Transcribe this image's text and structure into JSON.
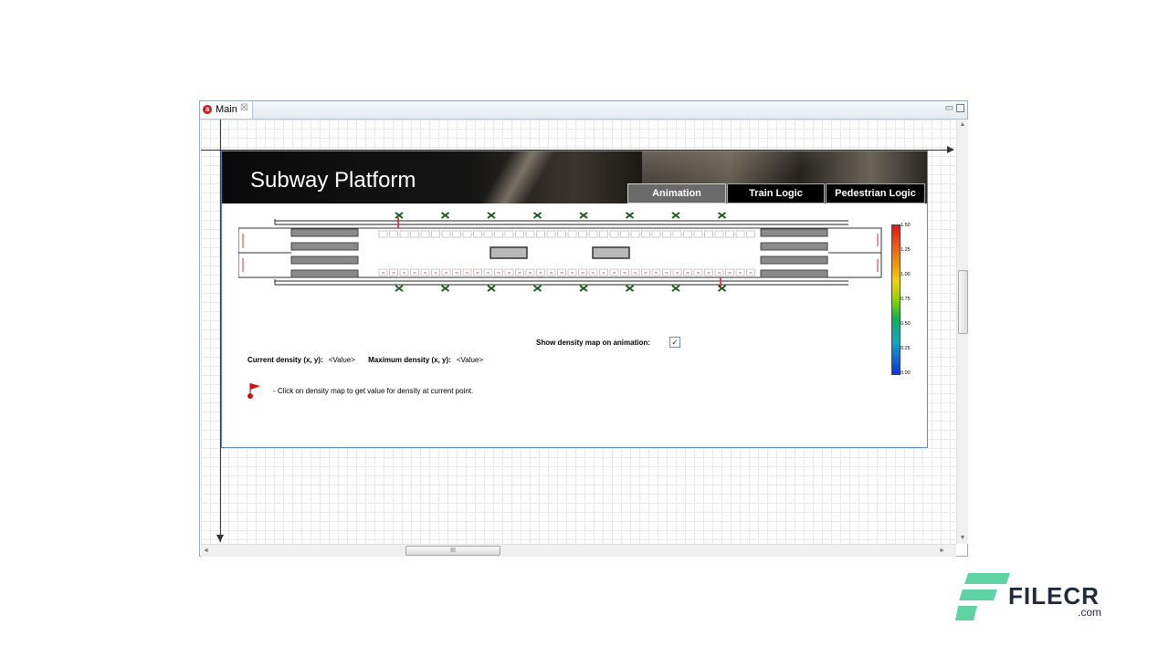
{
  "tab": {
    "label": "Main",
    "close": "☒",
    "icon": "anylogic-icon"
  },
  "window_buttons": {
    "minimize": "▭",
    "maximize": ""
  },
  "banner": {
    "title": "Subway Platform"
  },
  "nav": [
    {
      "label": "Animation",
      "active": true
    },
    {
      "label": "Train Logic",
      "active": false
    },
    {
      "label": "Pedestrian Logic",
      "active": false
    }
  ],
  "hint": {
    "text": "-   Click on density map to get value for density at current point."
  },
  "show_density": {
    "label": "Show density map on animation:",
    "checked": true,
    "mark": "✓"
  },
  "density": {
    "current_label": "Current density (x, y):",
    "current_value": "<Value>",
    "max_label": "Maximum density (x, y):",
    "max_value": "<Value>"
  },
  "scale_ticks": [
    "1.50",
    "1.25",
    "1.00",
    "0.75",
    "0.50",
    "0.25",
    "0.00"
  ],
  "scrollbar": {
    "hthumb_grip": "III",
    "up": "▲",
    "down": "▼",
    "left": "◄",
    "right": "►"
  },
  "watermark": {
    "brand": "FILECR",
    "suffix": ".com"
  },
  "colors": {
    "accent": "#5b88c0",
    "flag": "#cc1111",
    "scale_high": "#e8141a",
    "scale_low": "#1030e0"
  }
}
